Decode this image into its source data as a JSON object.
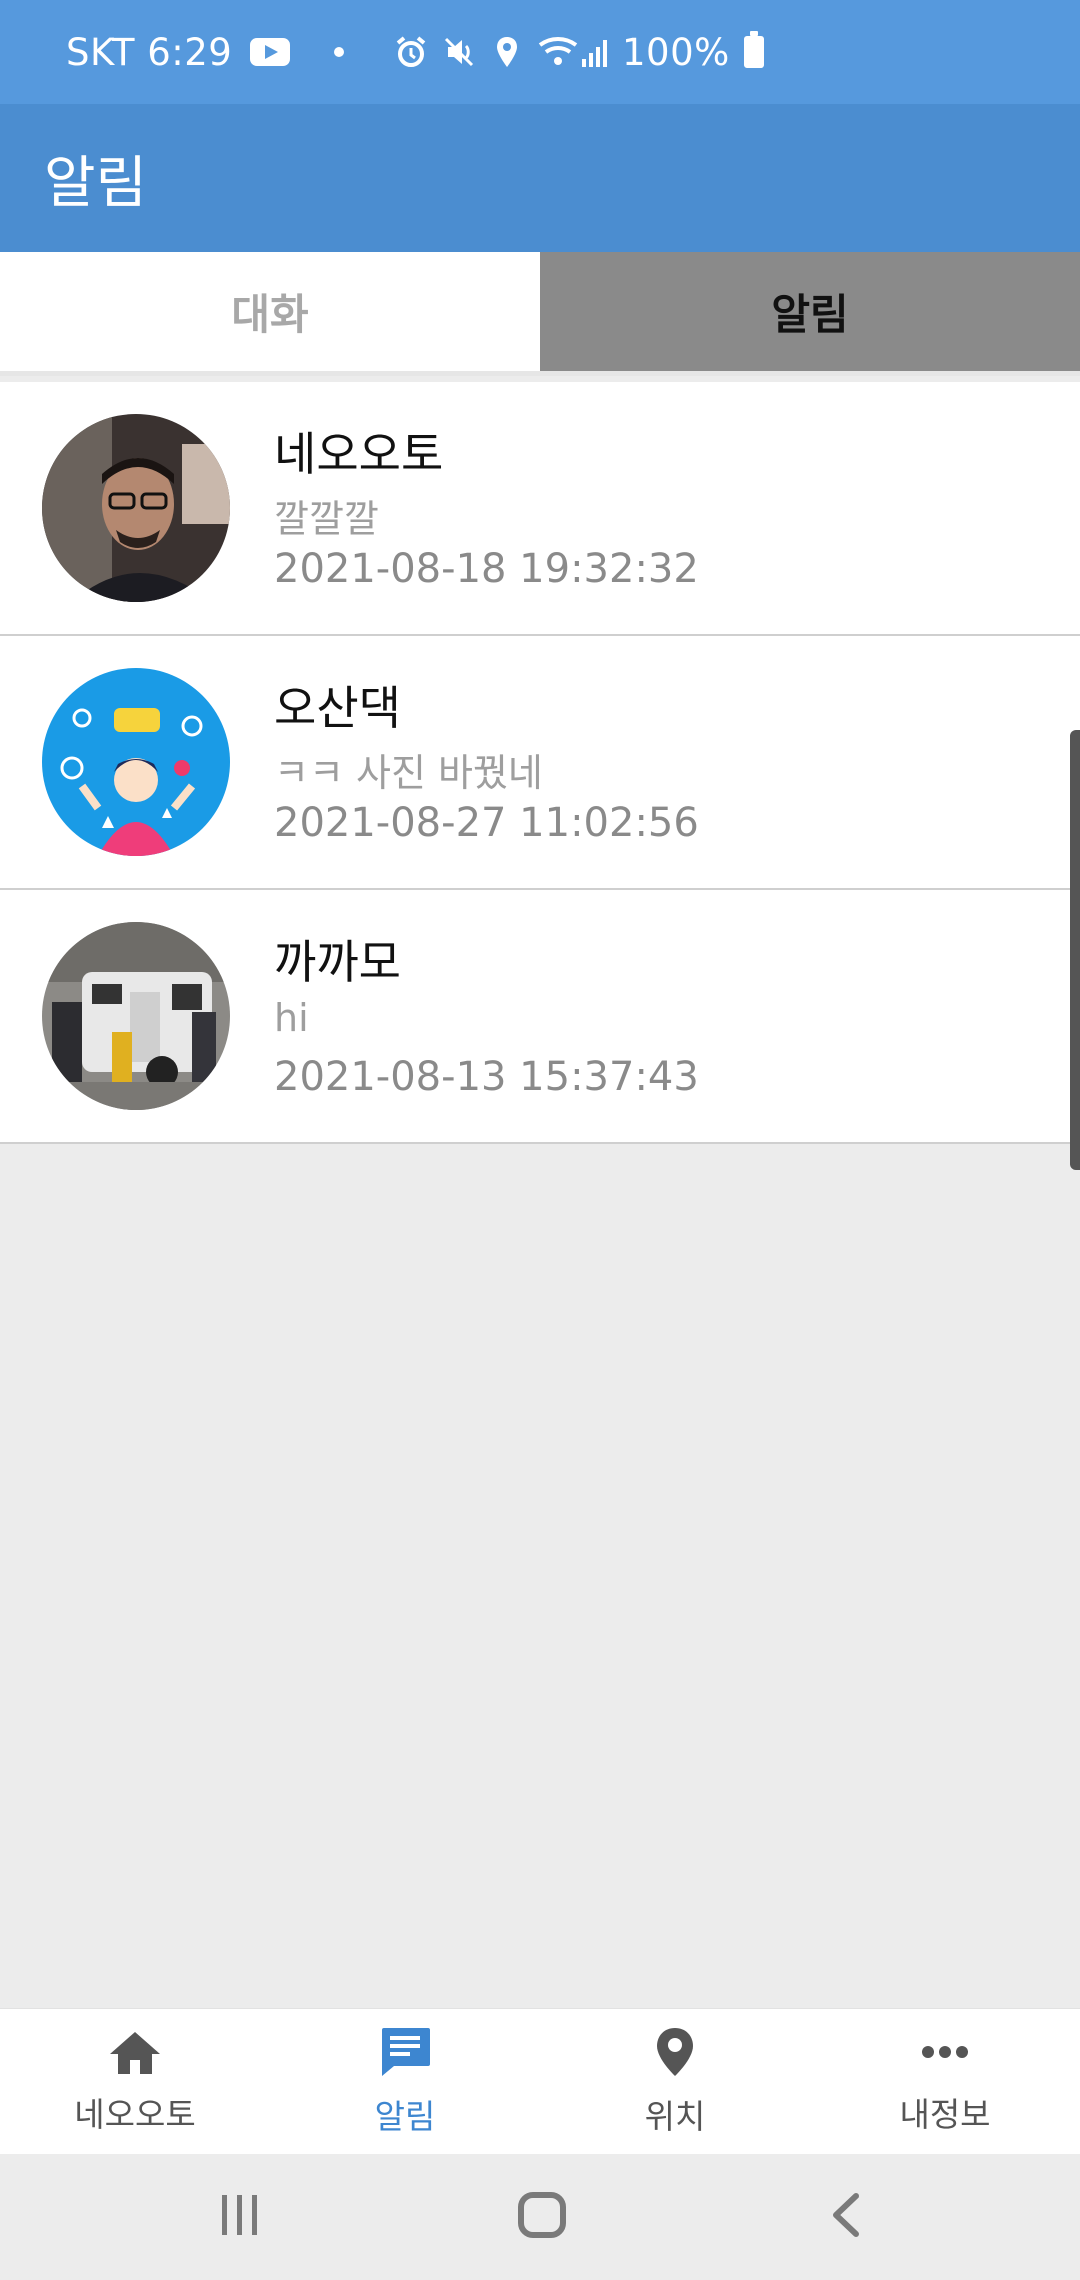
{
  "status_bar": {
    "carrier_time": "SKT 6:29",
    "battery": "100%"
  },
  "app_bar": {
    "title": "알림"
  },
  "tabs": [
    {
      "label": "대화",
      "active": false
    },
    {
      "label": "알림",
      "active": true
    }
  ],
  "conversations": [
    {
      "name": "네오오토",
      "message": "깔깔깔",
      "time": "2021-08-18 19:32:32",
      "avatar": "person-in-car-photo"
    },
    {
      "name": "오산댁",
      "message": "ㅋㅋ 사진 바꿨네",
      "time": "2021-08-27 11:02:56",
      "avatar": "thank-you-illustration"
    },
    {
      "name": "까까모",
      "message": "hi",
      "time": "2021-08-13 15:37:43",
      "avatar": "camper-trailer-photo"
    }
  ],
  "bottom_nav": [
    {
      "label": "네오오토",
      "icon": "home-icon",
      "active": false
    },
    {
      "label": "알림",
      "icon": "chat-icon",
      "active": true
    },
    {
      "label": "위치",
      "icon": "location-pin-icon",
      "active": false
    },
    {
      "label": "내정보",
      "icon": "more-icon",
      "active": false
    }
  ],
  "colors": {
    "status_bar": "#5699dd",
    "app_bar": "#4b8dd0",
    "active_nav": "#3d86d0",
    "active_tab_bg": "#8a8a8a"
  }
}
